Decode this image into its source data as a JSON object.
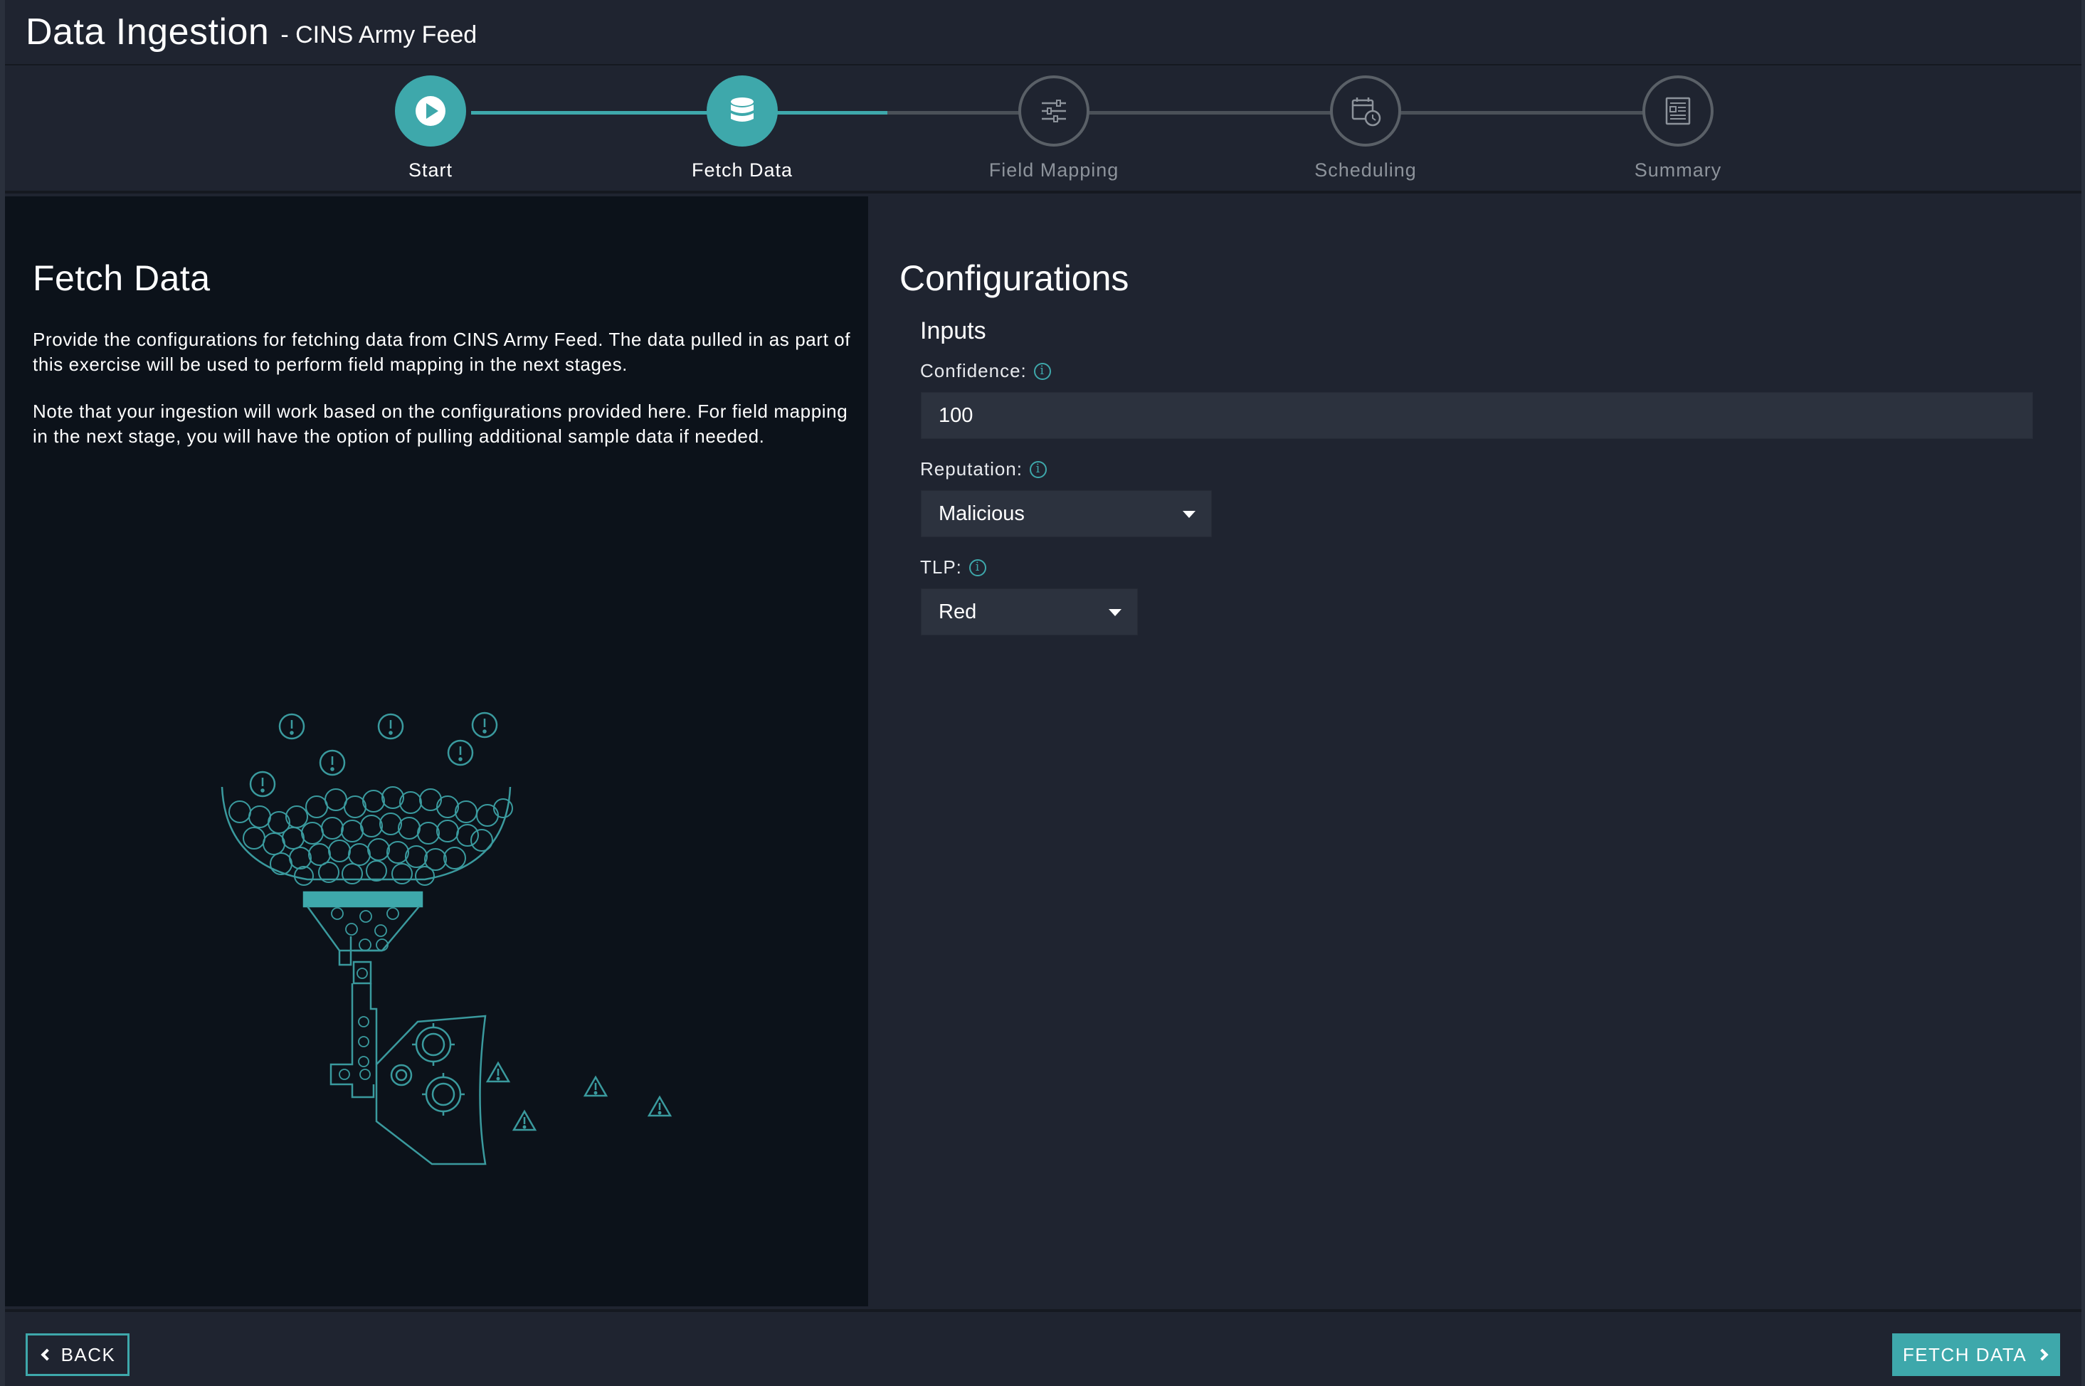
{
  "header": {
    "title": "Data Ingestion",
    "subtitle": "- CINS Army Feed"
  },
  "wizard": {
    "steps": [
      {
        "label": "Start",
        "icon": "play-icon",
        "state": "complete"
      },
      {
        "label": "Fetch Data",
        "icon": "database-icon",
        "state": "active"
      },
      {
        "label": "Field Mapping",
        "icon": "sliders-icon",
        "state": "pending"
      },
      {
        "label": "Scheduling",
        "icon": "calendar-clock-icon",
        "state": "pending"
      },
      {
        "label": "Summary",
        "icon": "document-icon",
        "state": "pending"
      }
    ]
  },
  "left": {
    "heading": "Fetch Data",
    "paragraph1": "Provide the configurations for fetching data from CINS Army Feed. The data pulled in as part of this exercise will be used to perform field mapping in the next stages.",
    "paragraph2": "Note that your ingestion will work based on the configurations provided here. For field mapping in the next stage, you will have the option of pulling additional sample data if needed."
  },
  "config": {
    "heading": "Configurations",
    "section": "Inputs",
    "confidence_label": "Confidence:",
    "confidence_value": "100",
    "reputation_label": "Reputation:",
    "reputation_value": "Malicious",
    "tlp_label": "TLP:",
    "tlp_value": "Red"
  },
  "footer": {
    "back_label": "BACK",
    "fetch_label": "FETCH DATA"
  },
  "colors": {
    "accent": "#3ea8ab",
    "background": "#1f2430",
    "left_panel": "#0c121a",
    "inactive_step": "#5a6067"
  }
}
